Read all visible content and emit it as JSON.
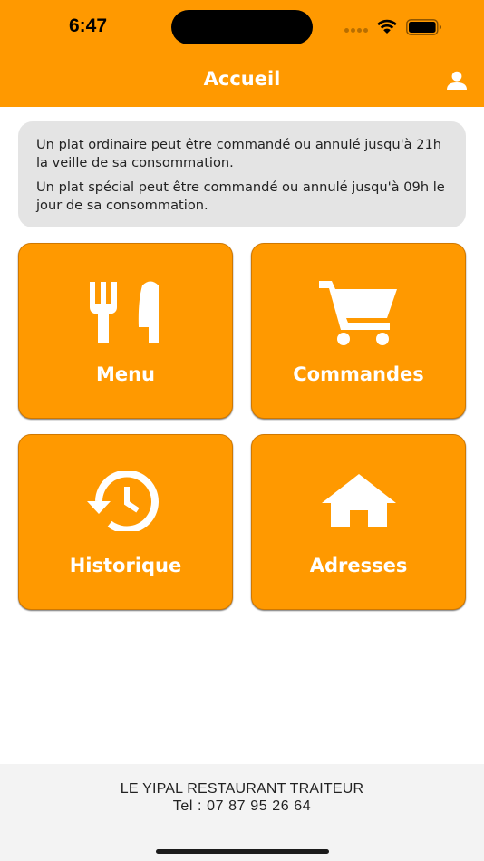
{
  "status_bar": {
    "time": "6:47"
  },
  "header": {
    "title": "Accueil",
    "profile_icon": "person-icon"
  },
  "info": {
    "line1": "Un plat ordinaire  peut être commandé ou annulé jusqu'à 21h la veille de sa consommation.",
    "line2": "Un plat spécial peut être commandé ou annulé jusqu'à 09h le jour de sa consommation."
  },
  "tiles": [
    {
      "label": "Menu",
      "icon": "fork-knife-icon"
    },
    {
      "label": "Commandes",
      "icon": "cart-icon"
    },
    {
      "label": "Historique",
      "icon": "history-icon"
    },
    {
      "label": "Adresses",
      "icon": "home-icon"
    }
  ],
  "footer": {
    "name": "LE YIPAL RESTAURANT TRAITEUR",
    "tel": "Tel : 07 87 95 26 64"
  },
  "colors": {
    "accent": "#FF9900",
    "info_bg": "#E4E4E4",
    "footer_bg": "#F3F3F3"
  }
}
